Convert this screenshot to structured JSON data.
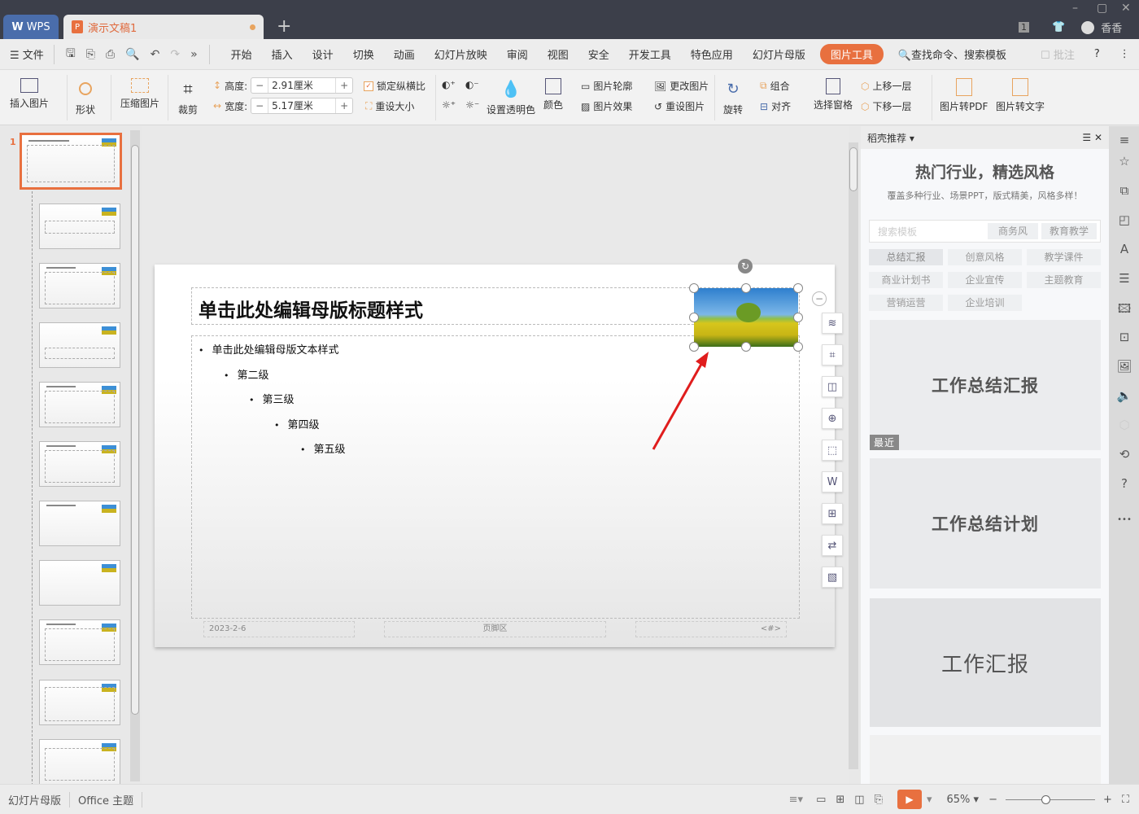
{
  "titlebar": {
    "app_tab": "WPS",
    "doc_tab": "演示文稿1",
    "add_tab": "+",
    "page_badge": "1",
    "user": "香香",
    "minimize": "–",
    "maximize": "▢",
    "close": "✕"
  },
  "menubar": {
    "file": "文件",
    "items": [
      "开始",
      "插入",
      "设计",
      "切换",
      "动画",
      "幻灯片放映",
      "审阅",
      "视图",
      "安全",
      "开发工具",
      "特色应用",
      "幻灯片母版",
      "图片工具"
    ],
    "active": "图片工具",
    "search": "查找命令、搜索模板",
    "comment": "批注",
    "help": "?"
  },
  "ribbon": {
    "insert_picture": "插入图片",
    "shape": "形状",
    "compress": "压缩图片",
    "crop": "裁剪",
    "height_label": "高度:",
    "height_value": "2.91厘米",
    "width_label": "宽度:",
    "width_value": "5.17厘米",
    "lock_ratio": "锁定纵横比",
    "lock_ratio_checked": true,
    "reset_size": "重设大小",
    "set_transparent": "设置透明色",
    "color": "颜色",
    "outline": "图片轮廓",
    "effect": "图片效果",
    "change_picture": "更改图片",
    "reset_picture": "重设图片",
    "rotate": "旋转",
    "group": "组合",
    "align": "对齐",
    "selection_pane": "选择窗格",
    "bring_forward": "上移一层",
    "send_backward": "下移一层",
    "to_pdf": "图片转PDF",
    "to_text": "图片转文字"
  },
  "thumbnails": {
    "selected_index": "1",
    "count": 11
  },
  "slide": {
    "title": "单击此处编辑母版标题样式",
    "bullets": [
      "单击此处编辑母版文本样式",
      "第二级",
      "第三级",
      "第四级",
      "第五级"
    ],
    "footer_date": "2023-2-6",
    "footer_center": "页脚区",
    "footer_number": "<#>"
  },
  "right_panel": {
    "header": "稻壳推荐",
    "title": "热门行业，精选风格",
    "subtitle": "覆盖多种行业、场景PPT，版式精美，风格多样！",
    "search_placeholder": "搜索模板",
    "quick_tags": [
      "商务风",
      "教育教学"
    ],
    "tags": [
      "总结汇报",
      "创意风格",
      "教学课件",
      "商业计划书",
      "企业宣传",
      "主题教育",
      "营销运营",
      "企业培训"
    ],
    "templates": [
      "工作总结汇报",
      "工作总结计划",
      "工作汇报",
      ""
    ],
    "recent_badge": "最近"
  },
  "status": {
    "mode": "幻灯片母版",
    "theme": "Office 主题",
    "zoom": "65%"
  }
}
